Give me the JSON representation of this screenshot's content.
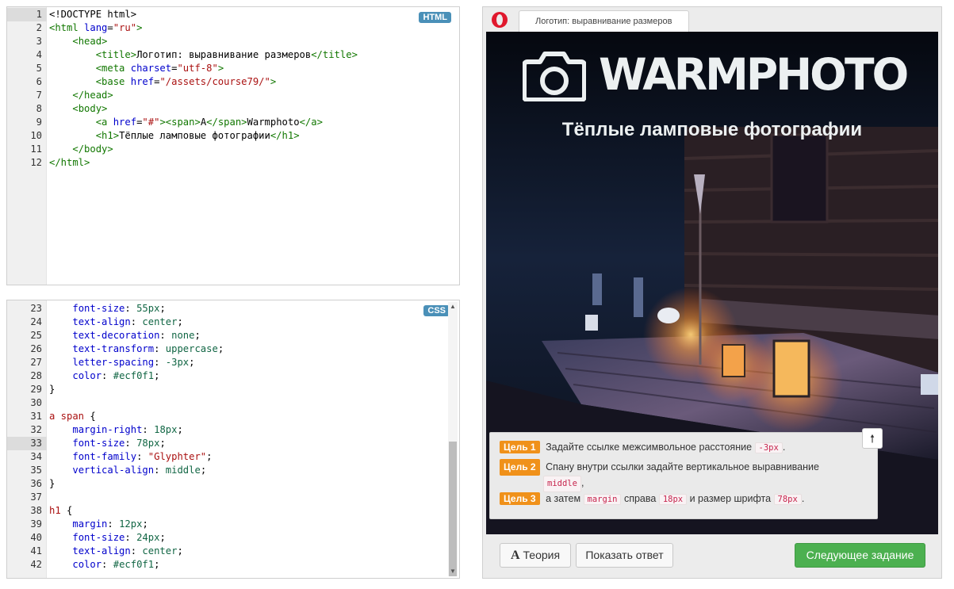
{
  "html_editor": {
    "badge": "HTML",
    "lines": [
      {
        "n": "1",
        "tokens": [
          [
            "t-plain",
            "<!DOCTYPE html>"
          ]
        ]
      },
      {
        "n": "2",
        "tokens": [
          [
            "t-tag",
            "<html "
          ],
          [
            "t-attr",
            "lang"
          ],
          [
            "t-plain",
            "="
          ],
          [
            "t-str",
            "\"ru\""
          ],
          [
            "t-tag",
            ">"
          ]
        ]
      },
      {
        "n": "3",
        "tokens": [
          [
            "t-plain",
            "    "
          ],
          [
            "t-tag",
            "<head>"
          ]
        ]
      },
      {
        "n": "4",
        "tokens": [
          [
            "t-plain",
            "        "
          ],
          [
            "t-tag",
            "<title>"
          ],
          [
            "t-plain",
            "Логотип: выравнивание размеров"
          ],
          [
            "t-tag",
            "</title>"
          ]
        ]
      },
      {
        "n": "5",
        "tokens": [
          [
            "t-plain",
            "        "
          ],
          [
            "t-tag",
            "<meta "
          ],
          [
            "t-attr",
            "charset"
          ],
          [
            "t-plain",
            "="
          ],
          [
            "t-str",
            "\"utf-8\""
          ],
          [
            "t-tag",
            ">"
          ]
        ]
      },
      {
        "n": "6",
        "tokens": [
          [
            "t-plain",
            "        "
          ],
          [
            "t-tag",
            "<base "
          ],
          [
            "t-attr",
            "href"
          ],
          [
            "t-plain",
            "="
          ],
          [
            "t-str",
            "\"/assets/course79/\""
          ],
          [
            "t-tag",
            ">"
          ]
        ]
      },
      {
        "n": "7",
        "tokens": [
          [
            "t-plain",
            "    "
          ],
          [
            "t-tag",
            "</head>"
          ]
        ]
      },
      {
        "n": "8",
        "tokens": [
          [
            "t-plain",
            "    "
          ],
          [
            "t-tag",
            "<body>"
          ]
        ]
      },
      {
        "n": "9",
        "tokens": [
          [
            "t-plain",
            "        "
          ],
          [
            "t-tag",
            "<a "
          ],
          [
            "t-attr",
            "href"
          ],
          [
            "t-plain",
            "="
          ],
          [
            "t-str",
            "\"#\""
          ],
          [
            "t-tag",
            "><span>"
          ],
          [
            "t-plain",
            "A"
          ],
          [
            "t-tag",
            "</span>"
          ],
          [
            "t-plain",
            "Warmphoto"
          ],
          [
            "t-tag",
            "</a>"
          ]
        ]
      },
      {
        "n": "10",
        "tokens": [
          [
            "t-plain",
            "        "
          ],
          [
            "t-tag",
            "<h1>"
          ],
          [
            "t-plain",
            "Тёплые ламповые фотографии"
          ],
          [
            "t-tag",
            "</h1>"
          ]
        ]
      },
      {
        "n": "11",
        "tokens": [
          [
            "t-plain",
            "    "
          ],
          [
            "t-tag",
            "</body>"
          ]
        ]
      },
      {
        "n": "12",
        "tokens": [
          [
            "t-tag",
            "</html>"
          ]
        ]
      }
    ],
    "active_line": "1"
  },
  "css_editor": {
    "badge": "CSS",
    "active_line": "33",
    "lines": [
      {
        "n": "23",
        "tokens": [
          [
            "t-plain",
            "    "
          ],
          [
            "t-prop",
            "font-size"
          ],
          [
            "t-plain",
            ": "
          ],
          [
            "t-num",
            "55px"
          ],
          [
            "t-plain",
            ";"
          ]
        ]
      },
      {
        "n": "24",
        "tokens": [
          [
            "t-plain",
            "    "
          ],
          [
            "t-prop",
            "text-align"
          ],
          [
            "t-plain",
            ": "
          ],
          [
            "t-kw",
            "center"
          ],
          [
            "t-plain",
            ";"
          ]
        ]
      },
      {
        "n": "25",
        "tokens": [
          [
            "t-plain",
            "    "
          ],
          [
            "t-prop",
            "text-decoration"
          ],
          [
            "t-plain",
            ": "
          ],
          [
            "t-kw",
            "none"
          ],
          [
            "t-plain",
            ";"
          ]
        ]
      },
      {
        "n": "26",
        "tokens": [
          [
            "t-plain",
            "    "
          ],
          [
            "t-prop",
            "text-transform"
          ],
          [
            "t-plain",
            ": "
          ],
          [
            "t-kw",
            "uppercase"
          ],
          [
            "t-plain",
            ";"
          ]
        ]
      },
      {
        "n": "27",
        "tokens": [
          [
            "t-plain",
            "    "
          ],
          [
            "t-prop",
            "letter-spacing"
          ],
          [
            "t-plain",
            ": "
          ],
          [
            "t-num",
            "-3px"
          ],
          [
            "t-plain",
            ";"
          ]
        ]
      },
      {
        "n": "28",
        "tokens": [
          [
            "t-plain",
            "    "
          ],
          [
            "t-prop",
            "color"
          ],
          [
            "t-plain",
            ": "
          ],
          [
            "t-num",
            "#ecf0f1"
          ],
          [
            "t-plain",
            ";"
          ]
        ]
      },
      {
        "n": "29",
        "tokens": [
          [
            "t-plain",
            "}"
          ]
        ]
      },
      {
        "n": "30",
        "tokens": []
      },
      {
        "n": "31",
        "tokens": [
          [
            "t-sel",
            "a span"
          ],
          [
            "t-plain",
            " {"
          ]
        ]
      },
      {
        "n": "32",
        "tokens": [
          [
            "t-plain",
            "    "
          ],
          [
            "t-prop",
            "margin-right"
          ],
          [
            "t-plain",
            ": "
          ],
          [
            "t-num",
            "18px"
          ],
          [
            "t-plain",
            ";"
          ]
        ]
      },
      {
        "n": "33",
        "tokens": [
          [
            "t-plain",
            "    "
          ],
          [
            "t-prop",
            "font-size"
          ],
          [
            "t-plain",
            ": "
          ],
          [
            "t-num",
            "78px"
          ],
          [
            "t-plain",
            ";"
          ]
        ]
      },
      {
        "n": "34",
        "tokens": [
          [
            "t-plain",
            "    "
          ],
          [
            "t-prop",
            "font-family"
          ],
          [
            "t-plain",
            ": "
          ],
          [
            "t-str",
            "\"Glyphter\""
          ],
          [
            "t-plain",
            ";"
          ]
        ]
      },
      {
        "n": "35",
        "tokens": [
          [
            "t-plain",
            "    "
          ],
          [
            "t-prop",
            "vertical-align"
          ],
          [
            "t-plain",
            ": "
          ],
          [
            "t-kw",
            "middle"
          ],
          [
            "t-plain",
            ";"
          ]
        ]
      },
      {
        "n": "36",
        "tokens": [
          [
            "t-plain",
            "}"
          ]
        ]
      },
      {
        "n": "37",
        "tokens": []
      },
      {
        "n": "38",
        "tokens": [
          [
            "t-sel",
            "h1"
          ],
          [
            "t-plain",
            " {"
          ]
        ]
      },
      {
        "n": "39",
        "tokens": [
          [
            "t-plain",
            "    "
          ],
          [
            "t-prop",
            "margin"
          ],
          [
            "t-plain",
            ": "
          ],
          [
            "t-num",
            "12px"
          ],
          [
            "t-plain",
            ";"
          ]
        ]
      },
      {
        "n": "40",
        "tokens": [
          [
            "t-plain",
            "    "
          ],
          [
            "t-prop",
            "font-size"
          ],
          [
            "t-plain",
            ": "
          ],
          [
            "t-num",
            "24px"
          ],
          [
            "t-plain",
            ";"
          ]
        ]
      },
      {
        "n": "41",
        "tokens": [
          [
            "t-plain",
            "    "
          ],
          [
            "t-prop",
            "text-align"
          ],
          [
            "t-plain",
            ": "
          ],
          [
            "t-kw",
            "center"
          ],
          [
            "t-plain",
            ";"
          ]
        ]
      },
      {
        "n": "42",
        "tokens": [
          [
            "t-plain",
            "    "
          ],
          [
            "t-prop",
            "color"
          ],
          [
            "t-plain",
            ": "
          ],
          [
            "t-num",
            "#ecf0f1"
          ],
          [
            "t-plain",
            ";"
          ]
        ]
      }
    ]
  },
  "preview": {
    "tab_title": "Логотип: выравнивание размеров",
    "logo_text": "Warmphoto",
    "heading": "Тёплые ламповые фотографии",
    "icons": {
      "browser": "opera-icon",
      "logo": "camera-icon",
      "scroll_up": "arrow-up-icon"
    }
  },
  "tasks": {
    "goal1_label": "Цель 1",
    "goal1_text": "Задайте ссылке межсимвольное расстояние",
    "goal1_code": "-3px",
    "goal1_end": ".",
    "goal2_label": "Цель 2",
    "goal2_text": "Спану внутри ссылки задайте вертикальное выравнивание",
    "goal2_code": "middle",
    "goal2_end": ",",
    "goal3_label": "Цель 3",
    "goal3_pre": "а затем",
    "goal3_code1": "margin",
    "goal3_mid": "справа",
    "goal3_code2": "18px",
    "goal3_and": "и размер шрифта",
    "goal3_code3": "78px",
    "goal3_end": "."
  },
  "buttons": {
    "theory": "Теория",
    "theory_icon_glyph": "A",
    "show_answer": "Показать ответ",
    "next_task": "Следующее задание"
  },
  "colors": {
    "accent_green": "#4cb050",
    "goal_orange": "#f0911a",
    "badge_blue": "#4a90b8"
  }
}
